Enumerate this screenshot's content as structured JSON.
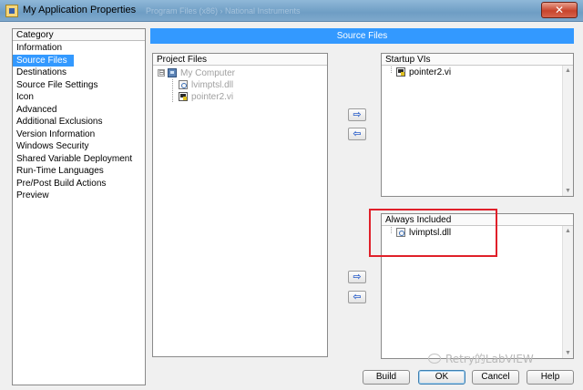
{
  "window": {
    "title": "My Application Properties",
    "background_text": "Program Files (x86) › National Instruments",
    "close_label": "✕"
  },
  "category": {
    "header": "Category",
    "items": [
      {
        "label": "Information",
        "selected": false
      },
      {
        "label": "Source Files",
        "selected": true
      },
      {
        "label": "Destinations",
        "selected": false
      },
      {
        "label": "Source File Settings",
        "selected": false
      },
      {
        "label": "Icon",
        "selected": false
      },
      {
        "label": "Advanced",
        "selected": false
      },
      {
        "label": "Additional Exclusions",
        "selected": false
      },
      {
        "label": "Version Information",
        "selected": false
      },
      {
        "label": "Windows Security",
        "selected": false
      },
      {
        "label": "Shared Variable Deployment",
        "selected": false
      },
      {
        "label": "Run-Time Languages",
        "selected": false
      },
      {
        "label": "Pre/Post Build Actions",
        "selected": false
      },
      {
        "label": "Preview",
        "selected": false
      }
    ]
  },
  "section_title": "Source Files",
  "project_files": {
    "header": "Project Files",
    "root": {
      "label": "My Computer",
      "icon": "computer-icon",
      "expander": "⊟"
    },
    "children": [
      {
        "label": "lvimptsl.dll",
        "icon": "dll-file-icon"
      },
      {
        "label": "pointer2.vi",
        "icon": "vi-file-icon"
      }
    ]
  },
  "startup_vis": {
    "header": "Startup VIs",
    "items": [
      {
        "label": "pointer2.vi",
        "icon": "vi-file-icon"
      }
    ]
  },
  "always_included": {
    "header": "Always Included",
    "items": [
      {
        "label": "lvimptsl.dll",
        "icon": "dll-file-icon"
      }
    ]
  },
  "arrows": {
    "add": "⇨",
    "remove": "⇦"
  },
  "buttons": {
    "build": "Build",
    "ok": "OK",
    "cancel": "Cancel",
    "help": "Help"
  },
  "watermark": "Retry的LabVIEW",
  "colors": {
    "selection": "#3399ff",
    "highlight_box": "#e0202a"
  }
}
